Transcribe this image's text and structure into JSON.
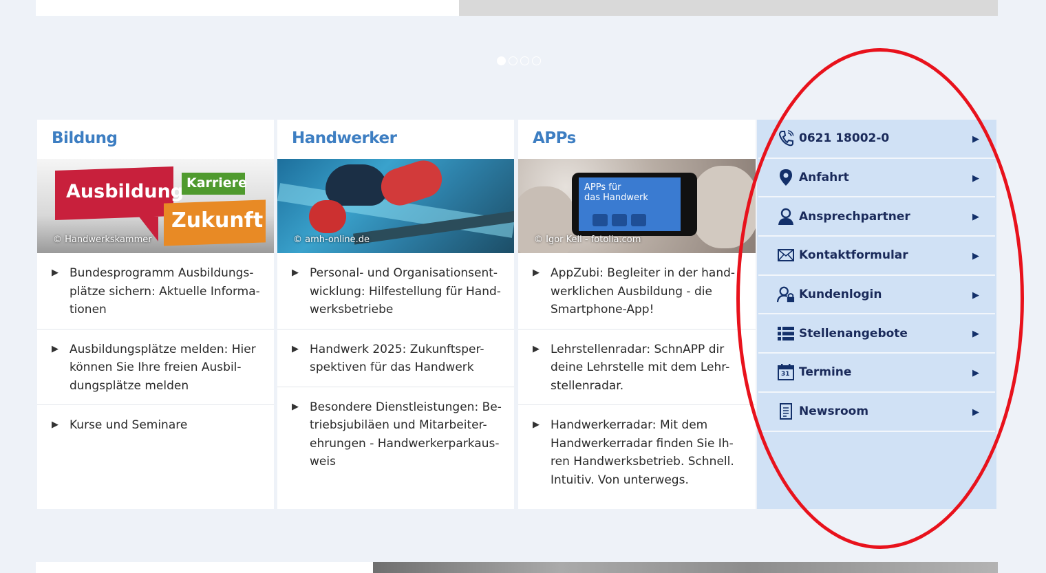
{
  "columns": [
    {
      "title": "Bildung",
      "image_credit": "© Handwerkskammer",
      "image_text": {
        "red": "Ausbildung",
        "green": "Karriere",
        "orange": "Zukunft"
      },
      "items": [
        [
          "Bundesprogramm Ausbildungs-",
          "plätze sichern: Aktuelle Informa-",
          "tionen"
        ],
        [
          "Ausbildungsplätze melden: Hier",
          "können Sie Ihre freien Ausbil-",
          "dungsplätze melden"
        ],
        [
          "Kurse und Seminare"
        ]
      ]
    },
    {
      "title": "Handwerker",
      "image_credit": "© amh-online.de",
      "items": [
        [
          "Personal- und Organisationsent-",
          "wicklung: Hilfestellung für Hand-",
          "werksbetriebe"
        ],
        [
          "Handwerk 2025: Zukunftsper-",
          "spektiven für das Handwerk"
        ],
        [
          "Besondere Dienstleistungen: Be-",
          "triebsjubiläen und Mitarbeiter-",
          "ehrungen - Handwerkerparkaus-",
          "weis"
        ]
      ]
    },
    {
      "title": "APPs",
      "image_credit": "© Igor Kell - fotolia.com",
      "tablet_text": [
        "APPs für",
        "das Handwerk"
      ],
      "items": [
        [
          "AppZubi: Begleiter in der hand-",
          "werklichen Ausbildung - die",
          "Smartphone-App!"
        ],
        [
          "Lehrstellenradar: SchnAPP dir",
          "deine Lehrstelle mit dem Lehr-",
          "stellenradar."
        ],
        [
          "Handwerkerradar: Mit dem",
          "Handwerkerradar finden Sie Ih-",
          "ren Handwerksbetrieb. Schnell.",
          "Intuitiv. Von unterwegs."
        ]
      ]
    }
  ],
  "sidebar": {
    "items": [
      {
        "label": "0621 18002-0",
        "icon": "phone-icon"
      },
      {
        "label": "Anfahrt",
        "icon": "location-pin-icon"
      },
      {
        "label": "Ansprechpartner",
        "icon": "person-icon"
      },
      {
        "label": "Kontaktformular",
        "icon": "envelope-icon"
      },
      {
        "label": "Kundenlogin",
        "icon": "user-lock-icon"
      },
      {
        "label": "Stellenangebote",
        "icon": "list-icon"
      },
      {
        "label": "Termine",
        "icon": "calendar-icon"
      },
      {
        "label": "Newsroom",
        "icon": "document-icon"
      }
    ],
    "calendar_day": "31",
    "arrow_glyph": "▶"
  },
  "slider": {
    "dots": 4,
    "active": 0
  },
  "colors": {
    "title_blue": "#3d7ec2",
    "sidebar_bg": "#d0e1f5",
    "sidebar_text": "#1a2a5a",
    "highlight_red": "#e8121c",
    "page_bg": "#eef2f8"
  }
}
